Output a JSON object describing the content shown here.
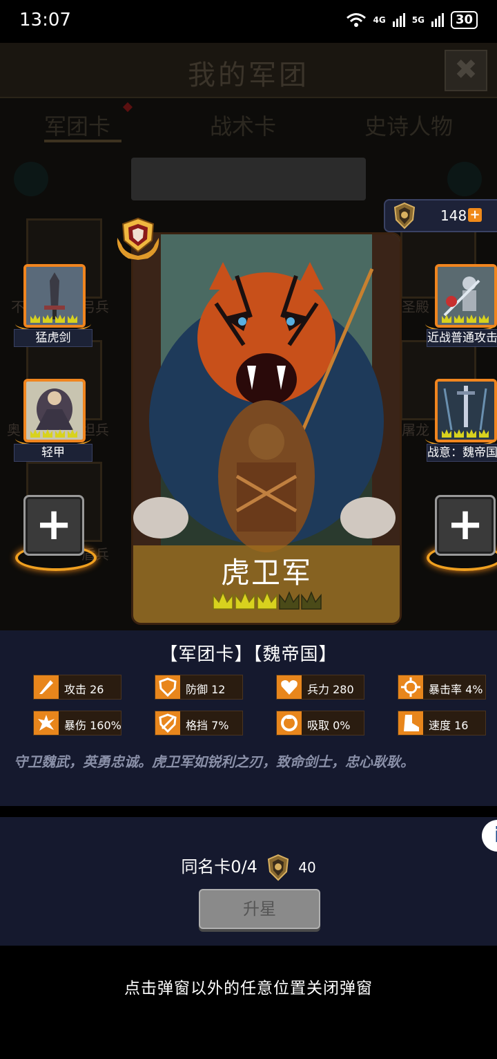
{
  "status_bar": {
    "time": "13:07",
    "net1": "4G",
    "net2": "5G",
    "battery": "30"
  },
  "background": {
    "title": "我的军团",
    "tabs": [
      "军团卡",
      "战术卡",
      "史诗人物"
    ],
    "partial_labels": [
      "不",
      "弓兵",
      "圣殿",
      "奥",
      "坦兵",
      "屠龙",
      "盾兵"
    ]
  },
  "currency": {
    "value": "148"
  },
  "card": {
    "name": "虎卫军",
    "stars_filled": 3,
    "stars_total": 5
  },
  "slots": {
    "left": [
      {
        "label": "猛虎剑"
      },
      {
        "label": "轻甲"
      }
    ],
    "right": [
      {
        "label": "近战普通攻击"
      },
      {
        "label": "战意：魏帝国"
      }
    ]
  },
  "info": {
    "category": "【军团卡】【魏帝国】",
    "stats": [
      {
        "label": "攻击 26",
        "icon": "sword-icon"
      },
      {
        "label": "防御 12",
        "icon": "shield-icon"
      },
      {
        "label": "兵力 280",
        "icon": "heart-icon"
      },
      {
        "label": "暴击率 4%",
        "icon": "crosshair-icon"
      },
      {
        "label": "暴伤 160%",
        "icon": "burst-icon"
      },
      {
        "label": "格挡 7%",
        "icon": "block-icon"
      },
      {
        "label": "吸取 0%",
        "icon": "drain-icon"
      },
      {
        "label": "速度 16",
        "icon": "boot-icon"
      }
    ],
    "description": "守卫魏武，英勇忠诚。虎卫军如锐利之刃，致命剑士，忠心耿耿。"
  },
  "upgrade": {
    "dup_label": "同名卡0/4",
    "cost": "40",
    "button": "升星"
  },
  "hint": "点击弹窗以外的任意位置关闭弹窗",
  "colors": {
    "accent": "#f0851f",
    "panel": "#15192e",
    "star": "#d8d21e"
  }
}
